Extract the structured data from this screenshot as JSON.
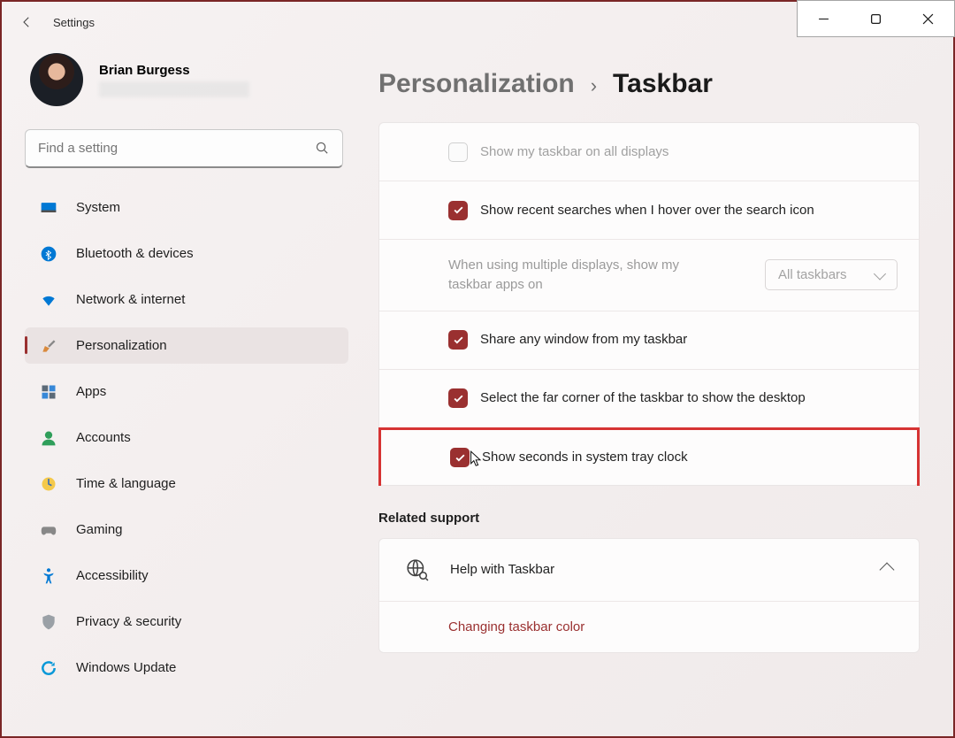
{
  "titlebar": {
    "title": "Settings"
  },
  "profile": {
    "name": "Brian Burgess"
  },
  "search": {
    "placeholder": "Find a setting"
  },
  "sidebar": {
    "items": [
      {
        "label": "System"
      },
      {
        "label": "Bluetooth & devices"
      },
      {
        "label": "Network & internet"
      },
      {
        "label": "Personalization"
      },
      {
        "label": "Apps"
      },
      {
        "label": "Accounts"
      },
      {
        "label": "Time & language"
      },
      {
        "label": "Gaming"
      },
      {
        "label": "Accessibility"
      },
      {
        "label": "Privacy & security"
      },
      {
        "label": "Windows Update"
      }
    ]
  },
  "breadcrumb": {
    "parent": "Personalization",
    "current": "Taskbar"
  },
  "settings": {
    "rows": [
      {
        "label": "Show my taskbar on all displays"
      },
      {
        "label": "Show recent searches when I hover over the search icon"
      },
      {
        "label": "When using multiple displays, show my taskbar apps on",
        "dropdown": "All taskbars"
      },
      {
        "label": "Share any window from my taskbar"
      },
      {
        "label": "Select the far corner of the taskbar to show the desktop"
      },
      {
        "label": "Show seconds in system tray clock"
      }
    ]
  },
  "related": {
    "title": "Related support"
  },
  "help": {
    "title": "Help with Taskbar",
    "link": "Changing taskbar color"
  }
}
